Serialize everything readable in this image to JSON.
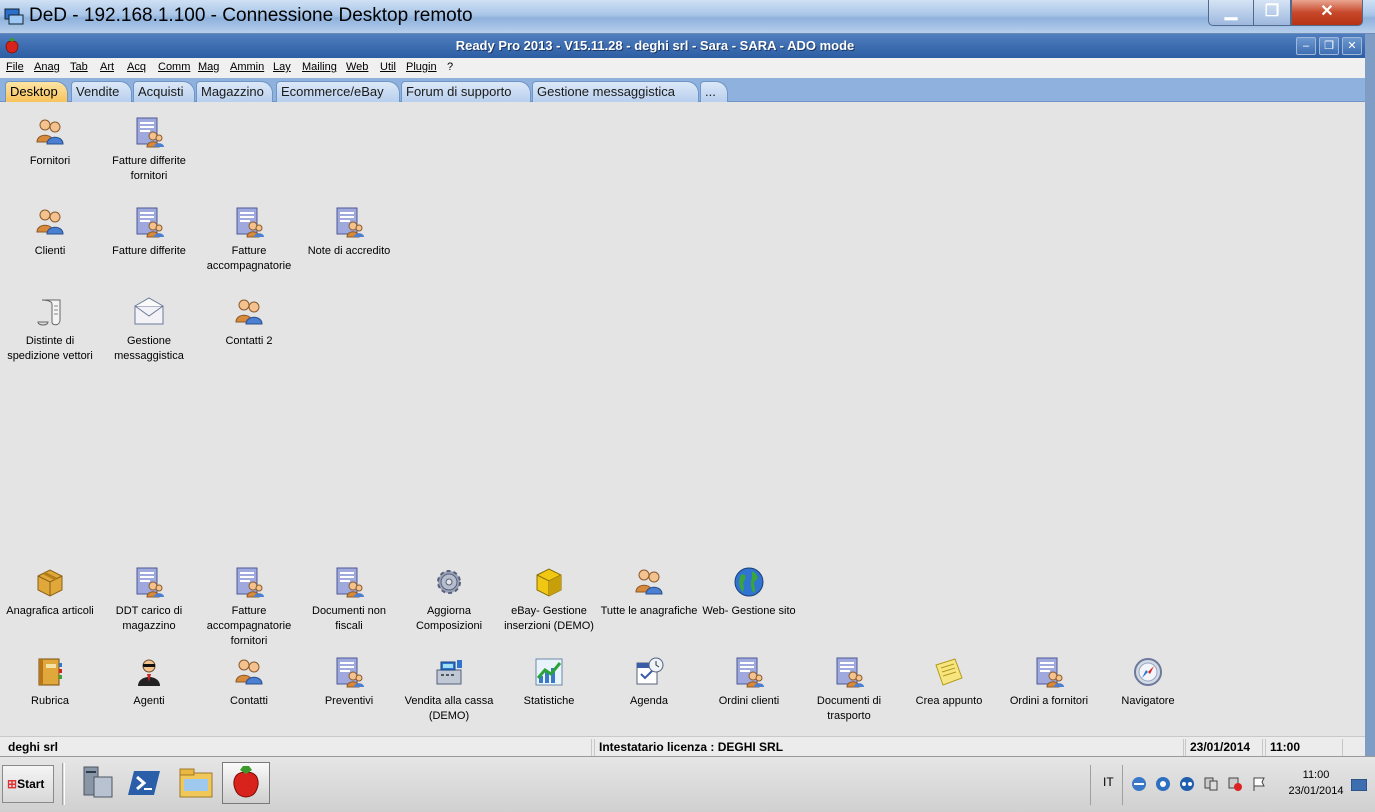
{
  "window": {
    "title": "DeD - 192.168.1.100 - Connessione Desktop remoto",
    "minimize_glyph": "▁",
    "maximize_glyph": "❐",
    "close_glyph": "✕"
  },
  "app": {
    "title": "Ready Pro 2013 - V15.11.28 - deghi srl - Sara - SARA - ADO mode",
    "min_glyph": "–",
    "restore_glyph": "❐",
    "close_glyph": "✕"
  },
  "menu": [
    "File",
    "Anag",
    "Tab",
    "Art",
    "Acq",
    "Comm",
    "Mag",
    "Ammin",
    "Lay",
    "Mailing",
    "Web",
    "Util",
    "Plugin",
    "?"
  ],
  "tabs": [
    "Desktop",
    "Vendite",
    "Acquisti",
    "Magazzino",
    "Ecommerce/eBay",
    "Forum di supporto",
    "Gestione messaggistica",
    "..."
  ],
  "desktop_icons": [
    {
      "label": "Fornitori",
      "icon": "people-icon"
    },
    {
      "label": "Fatture differite fornitori",
      "icon": "document-people-icon"
    },
    {
      "label": "Clienti",
      "icon": "people-icon"
    },
    {
      "label": "Fatture differite",
      "icon": "document-people-icon"
    },
    {
      "label": "Fatture accompagnatorie",
      "icon": "document-people-icon"
    },
    {
      "label": "Note di accredito",
      "icon": "document-people-icon"
    },
    {
      "label": "Distinte di spedizione vettori",
      "icon": "scroll-icon"
    },
    {
      "label": "Gestione messaggistica",
      "icon": "envelope-icon"
    },
    {
      "label": "Contatti 2",
      "icon": "people-icon"
    },
    {
      "label": "Anagrafica articoli",
      "icon": "box-icon"
    },
    {
      "label": "DDT carico di magazzino",
      "icon": "document-people-icon"
    },
    {
      "label": "Fatture accompagnatorie fornitori",
      "icon": "document-people-icon"
    },
    {
      "label": "Documenti non fiscali",
      "icon": "document-people-icon"
    },
    {
      "label": "Aggiorna Composizioni",
      "icon": "gear-icon"
    },
    {
      "label": "eBay- Gestione inserzioni (DEMO)",
      "icon": "cube-icon"
    },
    {
      "label": "Tutte le anagrafiche",
      "icon": "people-icon"
    },
    {
      "label": "Web- Gestione sito",
      "icon": "globe-icon"
    },
    {
      "label": "Rubrica",
      "icon": "book-icon"
    },
    {
      "label": "Agenti",
      "icon": "agent-icon"
    },
    {
      "label": "Contatti",
      "icon": "people-icon"
    },
    {
      "label": "Preventivi",
      "icon": "document-people-icon"
    },
    {
      "label": "Vendita alla cassa (DEMO)",
      "icon": "cash-register-icon"
    },
    {
      "label": "Statistiche",
      "icon": "chart-icon"
    },
    {
      "label": "Agenda",
      "icon": "calendar-icon"
    },
    {
      "label": "Ordini clienti",
      "icon": "document-people-icon"
    },
    {
      "label": "Documenti di trasporto",
      "icon": "document-people-icon"
    },
    {
      "label": "Crea appunto",
      "icon": "note-icon"
    },
    {
      "label": "Ordini a fornitori",
      "icon": "document-people-icon"
    },
    {
      "label": "Navigatore",
      "icon": "compass-icon"
    }
  ],
  "status": {
    "company": "deghi srl",
    "license": "Intestatario licenza : DEGHI SRL",
    "date": "23/01/2014",
    "time": "11:00"
  },
  "taskbar": {
    "start_label": "Start",
    "language": "IT",
    "clock_time": "11:00",
    "clock_date": "23/01/2014"
  },
  "colors": {
    "accent": "#2d5da3",
    "tab_active": "#f8c35c",
    "desktop_bg": "#e4e4e4"
  }
}
